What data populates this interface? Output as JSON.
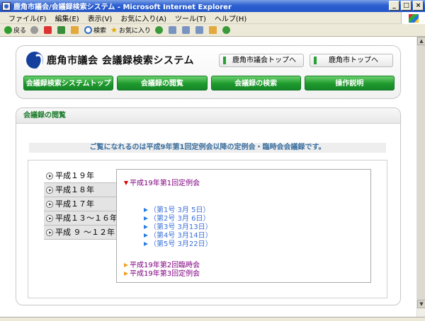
{
  "window": {
    "title": "鹿角市議会/会議録検索システム - Microsoft Internet Explorer",
    "controls": [
      "_",
      "□",
      "×"
    ]
  },
  "menubar": {
    "items": [
      "ファイル(F)",
      "編集(E)",
      "表示(V)",
      "お気に入り(A)",
      "ツール(T)",
      "ヘルプ(H)"
    ]
  },
  "toolbar": {
    "back": "戻る",
    "search": "検索",
    "favorites": "お気に入り"
  },
  "header": {
    "site_title": "鹿角市議会 会議録検索システム",
    "top_links": [
      "鹿角市議会トップへ",
      "鹿角市トップへ"
    ],
    "nav": [
      "会議録検索システムトップ",
      "会議録の閲覧",
      "会議録の検索",
      "操作説明"
    ]
  },
  "section": {
    "heading": "会議録の閲覧",
    "notice": "ご覧になれるのは平成9年第1回定例会以降の定例会・臨時会会議録です。",
    "years": [
      "平成１９年",
      "平成１８年",
      "平成１７年",
      "平成１３～１６年",
      "平成 ９ ～１２年"
    ],
    "selected_year": "平成１９年",
    "sessions": [
      {
        "label": "平成19年第1回定例会",
        "expanded": true,
        "issues": [
          "（第1号 3月 5日）",
          "（第2号 3月 6日）",
          "（第3号 3月13日）",
          "（第4号 3月14日）",
          "（第5号 3月22日）"
        ]
      },
      {
        "label": "平成19年第2回臨時会",
        "expanded": false
      },
      {
        "label": "平成19年第3回定例会",
        "expanded": false
      }
    ]
  },
  "colors": {
    "nav_green": "#1e9a2c",
    "heading_green": "#1a7a2a",
    "notice_blue": "#3a6fa0",
    "link_blue": "#3a6fd8",
    "visited_purple": "#800080"
  }
}
